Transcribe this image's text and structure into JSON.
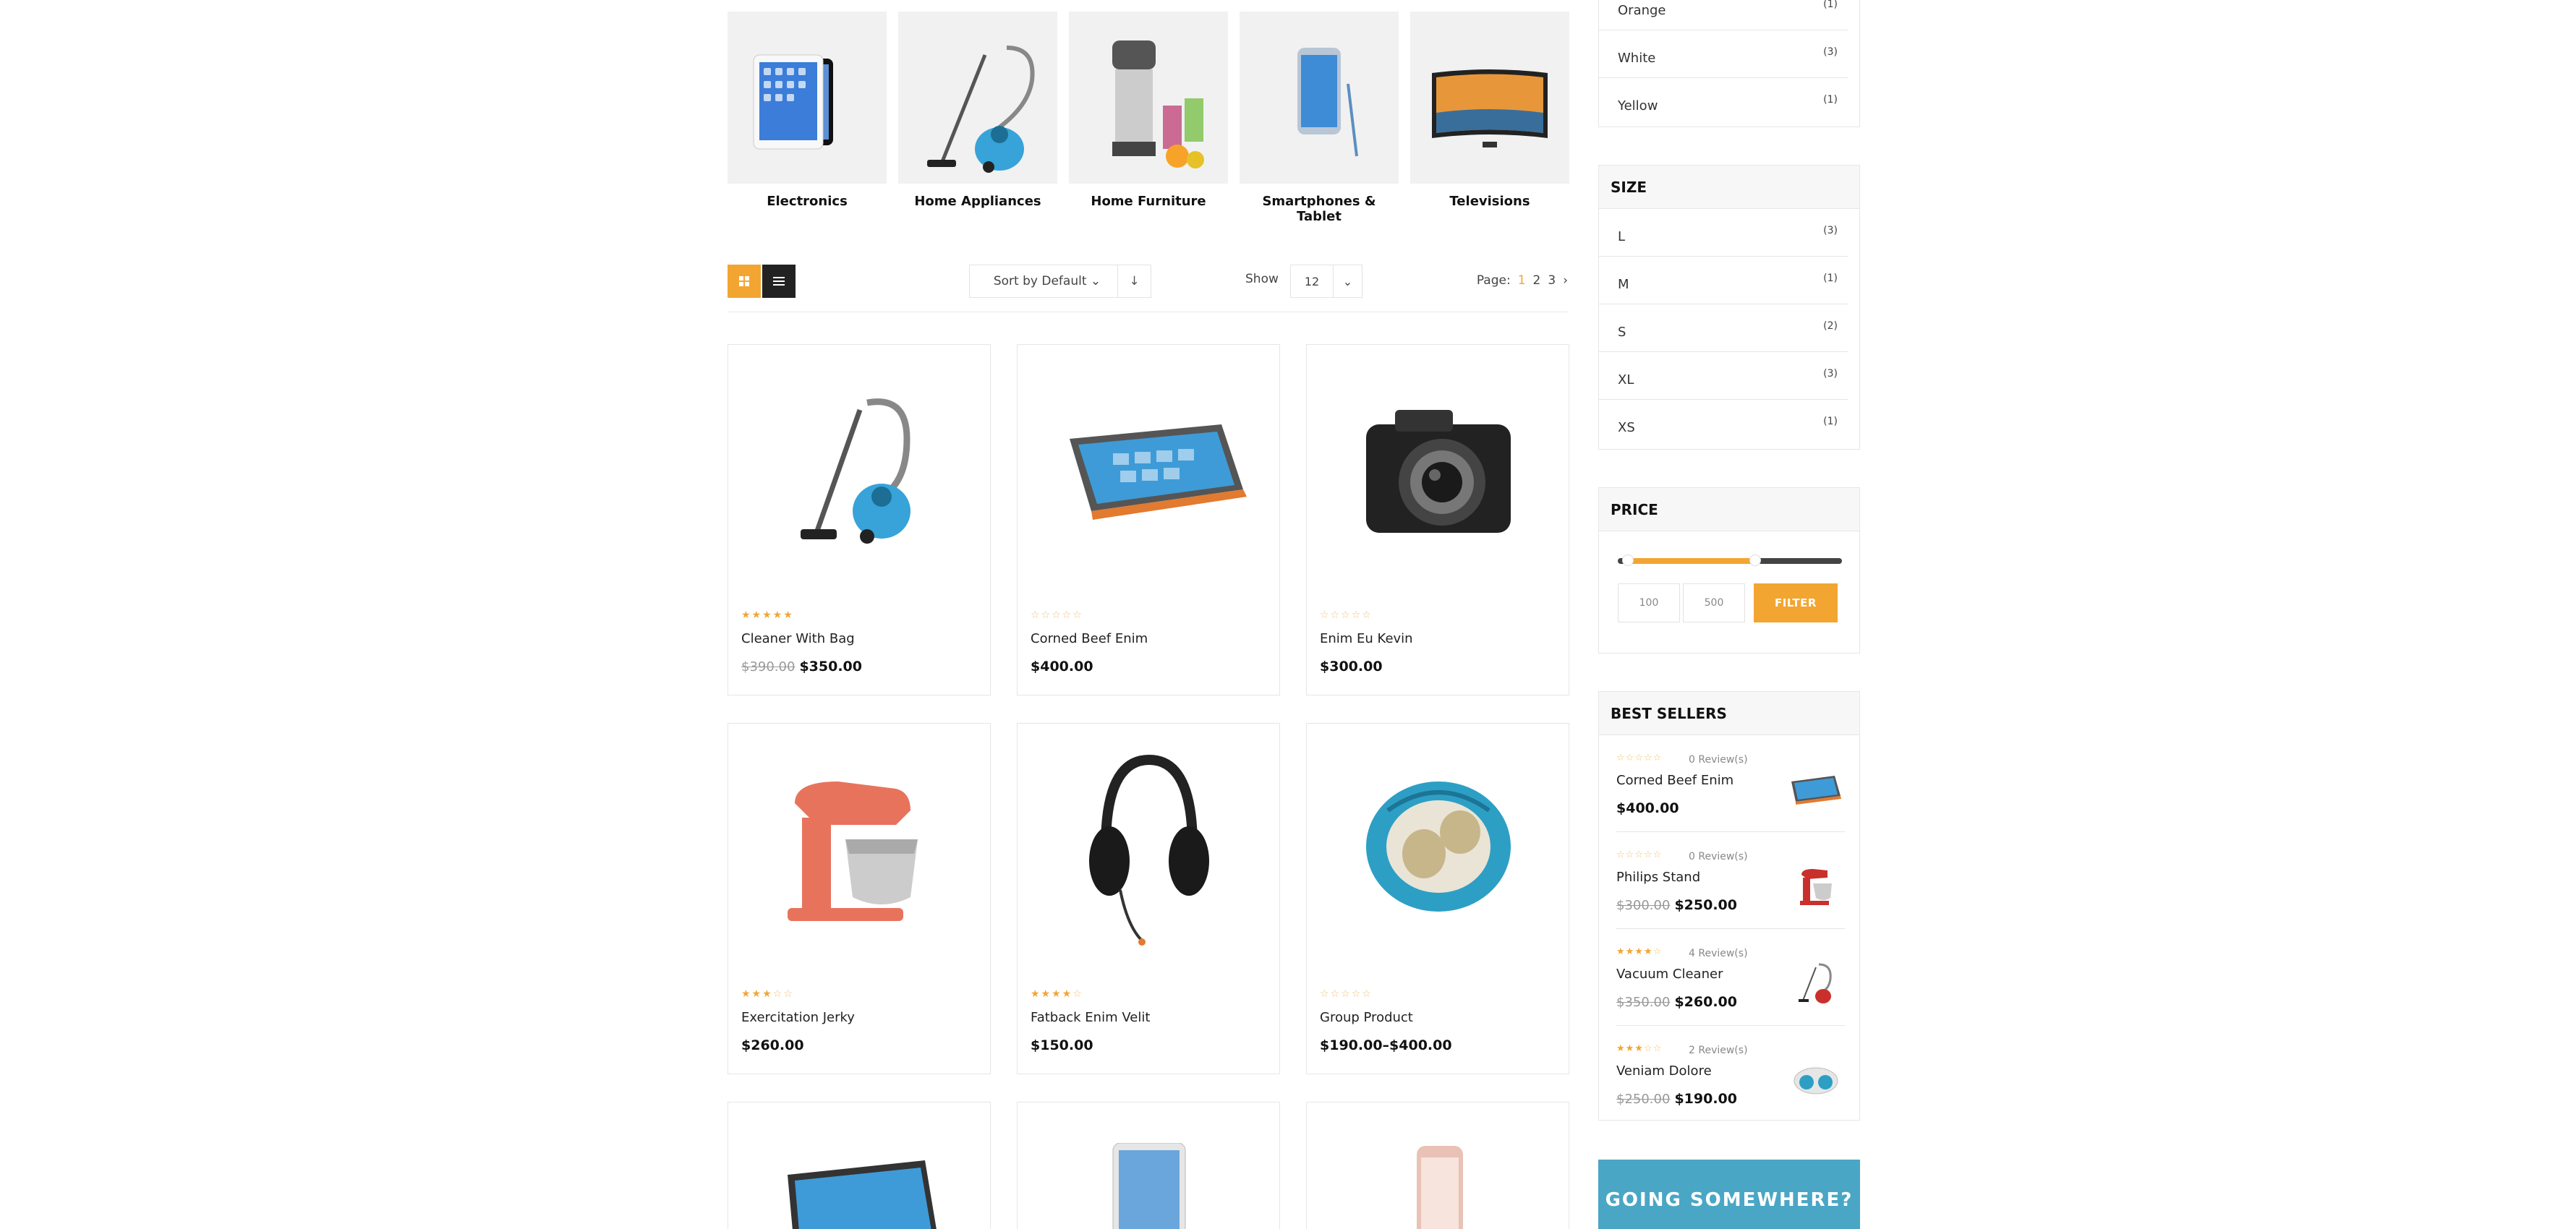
{
  "categories": [
    {
      "label": "Electronics",
      "icon": "tablet-image"
    },
    {
      "label": "Home Appliances",
      "icon": "vacuum-image"
    },
    {
      "label": "Home Furniture",
      "icon": "juicer-image"
    },
    {
      "label": "Smartphones & Tablet",
      "icon": "smartphone-image"
    },
    {
      "label": "Televisions",
      "icon": "tv-image"
    }
  ],
  "toolbar": {
    "sort_label": "Sort by Default",
    "sort_dir": "↓",
    "show_label": "Show",
    "show_value": "12",
    "page_label": "Page:",
    "pages": [
      "1",
      "2",
      "3"
    ],
    "next": "›"
  },
  "products": [
    {
      "name": "Cleaner With Bag",
      "old_price": "$390.00",
      "price": "$350.00",
      "rating": 4.5,
      "icon": "vacuum-image"
    },
    {
      "name": "Corned Beef Enim",
      "old_price": "",
      "price": "$400.00",
      "rating": 0,
      "icon": "laptop-image"
    },
    {
      "name": "Enim Eu Kevin",
      "old_price": "",
      "price": "$300.00",
      "rating": 0,
      "icon": "camera-image"
    },
    {
      "name": "Exercitation Jerky",
      "old_price": "",
      "price": "$260.00",
      "rating": 3,
      "icon": "mixer-image"
    },
    {
      "name": "Fatback Enim Velit",
      "old_price": "",
      "price": "$150.00",
      "rating": 3.5,
      "icon": "headphones-image"
    },
    {
      "name": "Group Product",
      "old_price": "",
      "price": "$190.00–$400.00",
      "rating": 0,
      "icon": "headphone-case-image"
    }
  ],
  "sidebar": {
    "colors": [
      {
        "name": "Orange",
        "count": "(1)"
      },
      {
        "name": "White",
        "count": "(3)"
      },
      {
        "name": "Yellow",
        "count": "(1)"
      }
    ],
    "size_title": "SIZE",
    "sizes": [
      {
        "name": "L",
        "count": "(3)"
      },
      {
        "name": "M",
        "count": "(1)"
      },
      {
        "name": "S",
        "count": "(2)"
      },
      {
        "name": "XL",
        "count": "(3)"
      },
      {
        "name": "XS",
        "count": "(1)"
      }
    ],
    "price_title": "PRICE",
    "price_min": "100",
    "price_max": "500",
    "filter_label": "FILTER",
    "best_title": "BEST SELLERS",
    "best_sellers": [
      {
        "name": "Corned Beef Enim",
        "reviews": "0 Review(s)",
        "old_price": "",
        "price": "$400.00",
        "rating": 0,
        "icon": "laptop-thumb"
      },
      {
        "name": "Philips Stand",
        "reviews": "0 Review(s)",
        "old_price": "$300.00",
        "price": "$250.00",
        "rating": 0,
        "icon": "mixer-thumb"
      },
      {
        "name": "Vacuum Cleaner",
        "reviews": "4 Review(s)",
        "old_price": "$350.00",
        "price": "$260.00",
        "rating": 4,
        "icon": "vacuum-thumb"
      },
      {
        "name": "Veniam Dolore",
        "reviews": "2 Review(s)",
        "old_price": "$250.00",
        "price": "$190.00",
        "rating": 3,
        "icon": "headphones-thumb"
      }
    ],
    "banner_text": "GOING SOMEWHERE?"
  },
  "colors": {
    "accent": "#f3a531",
    "dark": "#222222",
    "banner": "#4aa6c5"
  }
}
